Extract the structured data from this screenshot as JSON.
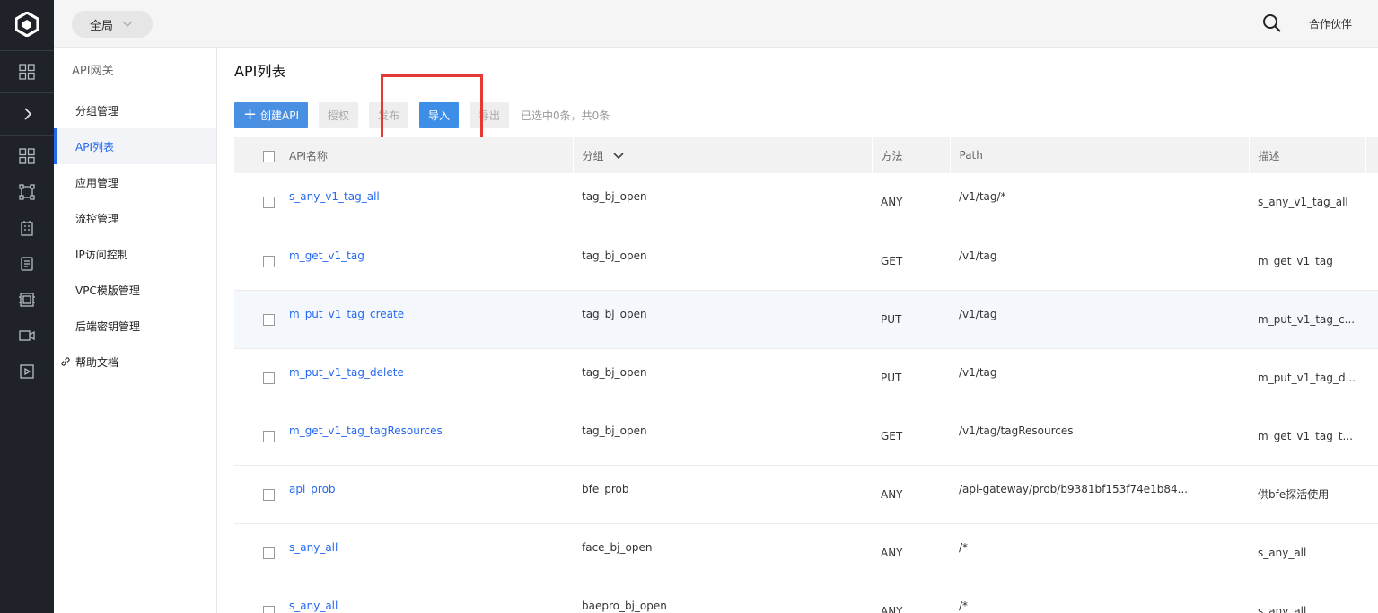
{
  "topbar": {
    "region": "全局",
    "partner": "合作伙伴"
  },
  "sidenav": {
    "title": "API网关",
    "items": [
      {
        "label": "分组管理"
      },
      {
        "label": "API列表"
      },
      {
        "label": "应用管理"
      },
      {
        "label": "流控管理"
      },
      {
        "label": "IP访问控制"
      },
      {
        "label": "VPC模版管理"
      },
      {
        "label": "后端密钥管理"
      },
      {
        "label": "帮助文档"
      }
    ]
  },
  "main": {
    "title": "API列表",
    "toolbar": {
      "create": "创建API",
      "authorize": "授权",
      "publish": "发布",
      "import": "导入",
      "export": "导出",
      "selection": "已选中0条，共0条"
    },
    "columns": {
      "name": "API名称",
      "group": "分组",
      "method": "方法",
      "path": "Path",
      "desc": "描述"
    },
    "rows": [
      {
        "name": "s_any_v1_tag_all",
        "group": "tag_bj_open",
        "method": "ANY",
        "path": "/v1/tag/*",
        "desc": "s_any_v1_tag_all"
      },
      {
        "name": "m_get_v1_tag",
        "group": "tag_bj_open",
        "method": "GET",
        "path": "/v1/tag",
        "desc": "m_get_v1_tag"
      },
      {
        "name": "m_put_v1_tag_create",
        "group": "tag_bj_open",
        "method": "PUT",
        "path": "/v1/tag",
        "desc": "m_put_v1_tag_c..."
      },
      {
        "name": "m_put_v1_tag_delete",
        "group": "tag_bj_open",
        "method": "PUT",
        "path": "/v1/tag",
        "desc": "m_put_v1_tag_d..."
      },
      {
        "name": "m_get_v1_tag_tagResources",
        "group": "tag_bj_open",
        "method": "GET",
        "path": "/v1/tag/tagResources",
        "desc": "m_get_v1_tag_t..."
      },
      {
        "name": "api_prob",
        "group": "bfe_prob",
        "method": "ANY",
        "path": "/api-gateway/prob/b9381bf153f74e1b84...",
        "desc": "供bfe探活使用"
      },
      {
        "name": "s_any_all",
        "group": "face_bj_open",
        "method": "ANY",
        "path": "/*",
        "desc": "s_any_all"
      },
      {
        "name": "s_any_all",
        "group": "baepro_bj_open",
        "method": "ANY",
        "path": "/*",
        "desc": "s_any_all"
      }
    ]
  }
}
